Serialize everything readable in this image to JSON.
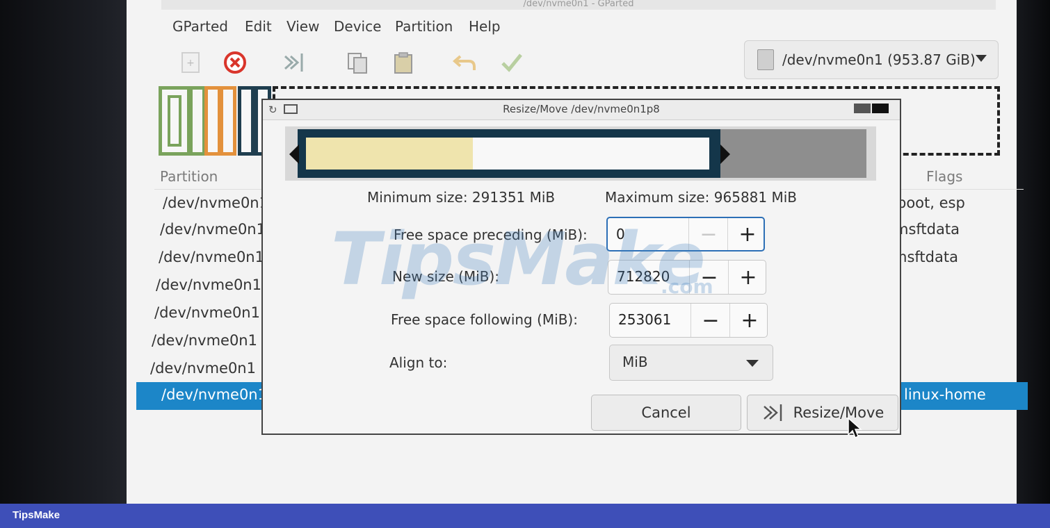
{
  "window": {
    "title": "/dev/nvme0n1 - GParted"
  },
  "menubar": {
    "items": [
      "GParted",
      "Edit",
      "View",
      "Device",
      "Partition",
      "Help"
    ]
  },
  "toolbar": {
    "device_selector": "/dev/nvme0n1 (953.87 GiB)"
  },
  "partition_list": {
    "headers": {
      "partition": "Partition",
      "flags": "Flags"
    },
    "rows": [
      {
        "device": "/dev/nvme0n1",
        "flags": "boot, esp"
      },
      {
        "device": "/dev/nvme0n1",
        "flags": "msftdata"
      },
      {
        "device": "/dev/nvme0n1",
        "flags": "msftdata"
      },
      {
        "device": "/dev/nvme0n1",
        "flags": ""
      },
      {
        "device": "/dev/nvme0n1",
        "flags": ""
      },
      {
        "device": "/dev/nvme0n1",
        "flags": ""
      },
      {
        "device": "/dev/nvme0n1",
        "flags": ""
      },
      {
        "device": "/dev/nvme0n1",
        "flags": "linux-home"
      }
    ]
  },
  "dialog": {
    "title": "Resize/Move /dev/nvme0n1p8",
    "min_size": "Minimum size: 291351 MiB",
    "max_size": "Maximum size: 965881 MiB",
    "free_preceding_label": "Free space preceding (MiB):",
    "free_preceding_value": "0",
    "new_size_label": "New size (MiB):",
    "new_size_value": "712820",
    "free_following_label": "Free space following (MiB):",
    "free_following_value": "253061",
    "align_label": "Align to:",
    "align_value": "MiB",
    "cancel_label": "Cancel",
    "resize_label": "Resize/Move",
    "minus_symbol": "−",
    "plus_symbol": "+"
  },
  "watermark": {
    "text": "TipsMake",
    "suffix": ".com"
  },
  "footer": {
    "brand": "TipsMake"
  },
  "colors": {
    "selection": "#1c86c8",
    "footer": "#3e4fb8",
    "partition_used": "#efe4ad",
    "partition_border": "#14364a"
  }
}
